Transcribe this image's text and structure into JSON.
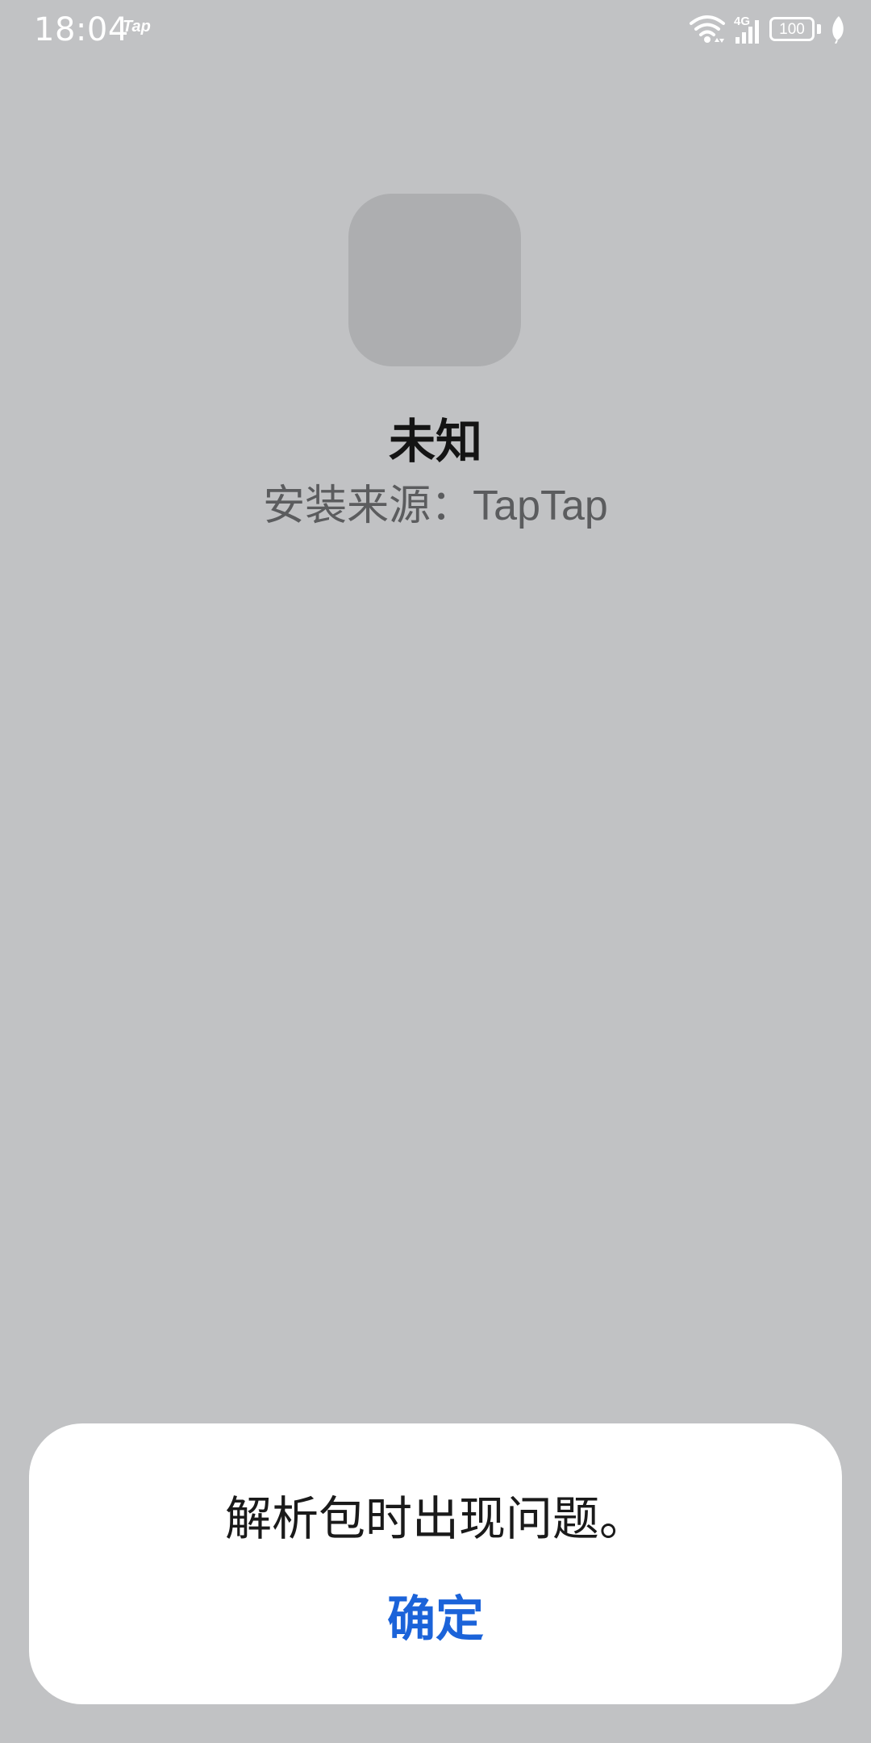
{
  "status_bar": {
    "time": "18:04",
    "carrier_app": "Tap",
    "network_type": "4G",
    "battery_level": "100",
    "icons": [
      "wifi-icon",
      "signal-icon",
      "battery-icon",
      "leaf-icon"
    ]
  },
  "app": {
    "name": "未知",
    "install_source_label": "安装来源：",
    "install_source_value": "TapTap"
  },
  "dialog": {
    "message": "解析包时出现问题。",
    "confirm_label": "确定"
  },
  "colors": {
    "background": "#c1c2c4",
    "dialog": "#ffffff",
    "accent": "#1b63d9"
  }
}
